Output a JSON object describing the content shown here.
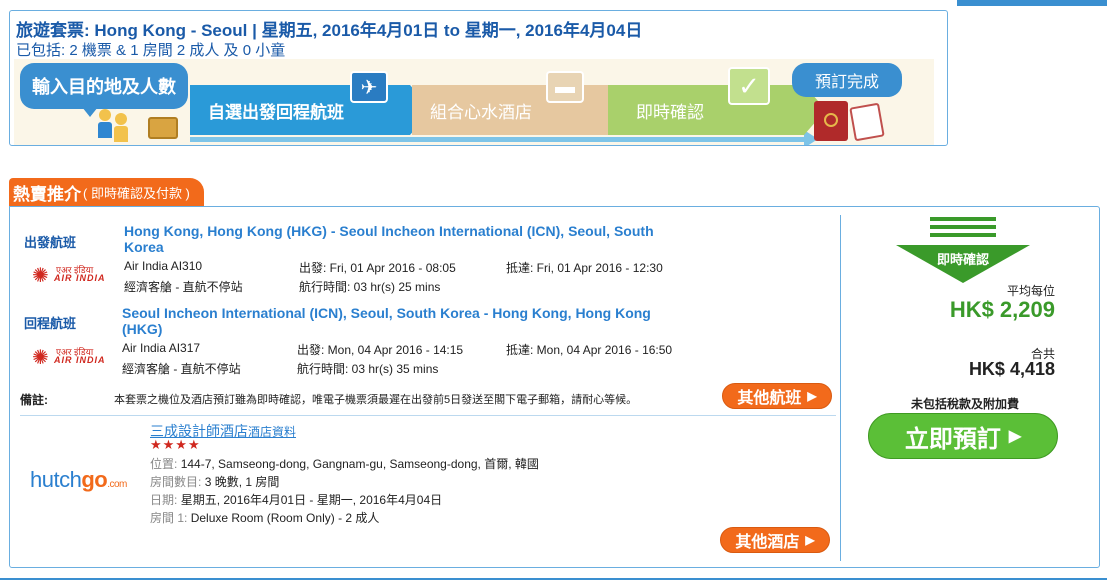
{
  "header": {
    "title_label": "旅遊套票:",
    "title_text": "Hong Kong - Seoul | 星期五, 2016年4月01日 to 星期一, 2016年4月04日",
    "included_label": "已包括:",
    "included_text": "2 機票 & 1 房間 2 成人 及 0 小童"
  },
  "steps": [
    {
      "label": "輸入目的地及人數",
      "icon": "people-icon"
    },
    {
      "label": "自選出發回程航班",
      "icon": "plane-icon"
    },
    {
      "label": "組合心水酒店",
      "icon": "bed-icon"
    },
    {
      "label": "即時確認",
      "icon": "check-icon"
    },
    {
      "label": "預訂完成",
      "icon": "passport-icon"
    }
  ],
  "tab": {
    "main": "熱賣推介",
    "sub": "( 即時確認及付款 )"
  },
  "outbound": {
    "label": "出發航班",
    "route": "Hong Kong, Hong Kong (HKG) - Seoul Incheon International (ICN), Seoul, South Korea",
    "airline": "Air India",
    "flight_no": "AI310",
    "cabin": "經濟客艙 - 直航不停站",
    "depart": "出發: Fri, 01 Apr 2016 - 08:05",
    "duration": "航行時間: 03 hr(s) 25 mins",
    "arrive": "抵達: Fri, 01 Apr 2016 - 12:30"
  },
  "return": {
    "label": "回程航班",
    "route": "Seoul Incheon International (ICN), Seoul, South Korea - Hong Kong, Hong Kong (HKG)",
    "airline": "Air India",
    "flight_no": "AI317",
    "cabin": "經濟客艙 - 直航不停站",
    "depart": "出發: Mon, 04 Apr 2016 - 14:15",
    "duration": "航行時間: 03 hr(s) 35 mins",
    "arrive": "抵達: Mon, 04 Apr 2016 - 16:50"
  },
  "airline_logo": {
    "hindi": "एअर इंडिया",
    "name": "AIR INDIA"
  },
  "remarks": {
    "label": "備註:",
    "text": "本套票之機位及酒店預訂雖為即時確認，唯電子機票須最遲在出發前5日發送至閣下電子郵箱，請耐心等候。"
  },
  "other_flights_button": "其他航班",
  "hotel": {
    "logo_main": "hutch",
    "logo_go": "go",
    "logo_com": ".com",
    "name": "三成設計師酒店",
    "info_link": "酒店資料",
    "stars": "★★★★",
    "location_label": "位置:",
    "location": "144-7, Samseong-dong, Gangnam-gu, Samseong-dong, 首爾, 韓國",
    "rooms_label": "房間數目:",
    "rooms": "3 晚數, 1 房間",
    "dates_label": "日期:",
    "dates": "星期五, 2016年4月01日 - 星期一, 2016年4月04日",
    "room_label": "房間 1:",
    "room": "Deluxe Room (Room Only) - 2 成人"
  },
  "other_hotels_button": "其他酒店",
  "price": {
    "confirm_badge": "即時確認",
    "avg_label": "平均每位",
    "avg_price": "HK$ 2,209",
    "total_label": "合共",
    "total_price": "HK$ 4,418",
    "exclusion": "未包括稅款及附加費",
    "book_button": "立即預訂"
  },
  "colors": {
    "brand_blue": "#1a5aa8",
    "accent_orange": "#f26a1b",
    "price_green": "#3a9a2a",
    "book_green": "#5bbf37"
  }
}
